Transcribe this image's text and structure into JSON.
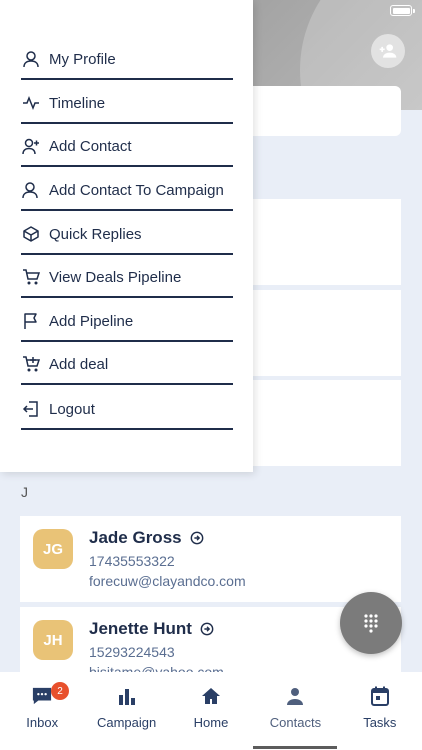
{
  "drawer": {
    "items": [
      {
        "label": "My Profile",
        "icon": "user-icon"
      },
      {
        "label": "Timeline",
        "icon": "activity-icon"
      },
      {
        "label": "Add Contact",
        "icon": "user-plus-icon"
      },
      {
        "label": "Add Contact To Campaign",
        "icon": "user-campaign-icon"
      },
      {
        "label": "Quick Replies",
        "icon": "box-icon"
      },
      {
        "label": "View Deals Pipeline",
        "icon": "cart-icon"
      },
      {
        "label": "Add Pipeline",
        "icon": "flag-icon"
      },
      {
        "label": "Add deal",
        "icon": "cart-plus-icon"
      },
      {
        "label": "Logout",
        "icon": "logout-icon"
      }
    ]
  },
  "contacts": {
    "section_letter": "J",
    "list": [
      {
        "initials": "JG",
        "name": "Jade Gross",
        "phone": "17435553322",
        "email": "forecuw@clayandco.com"
      },
      {
        "initials": "JH",
        "name": "Jenette Hunt",
        "phone": "15293224543",
        "email": "bisitame@yahoo.com"
      }
    ]
  },
  "nav": {
    "items": [
      {
        "label": "Inbox",
        "icon": "chat-icon",
        "badge": "2"
      },
      {
        "label": "Campaign",
        "icon": "bar-chart-icon"
      },
      {
        "label": "Home",
        "icon": "home-icon"
      },
      {
        "label": "Contacts",
        "icon": "person-icon",
        "active": true
      },
      {
        "label": "Tasks",
        "icon": "calendar-icon"
      }
    ]
  },
  "colors": {
    "navy": "#1f2d4a",
    "background": "#e9eef7",
    "avatar": "#e9c377",
    "badge": "#e8502c"
  }
}
